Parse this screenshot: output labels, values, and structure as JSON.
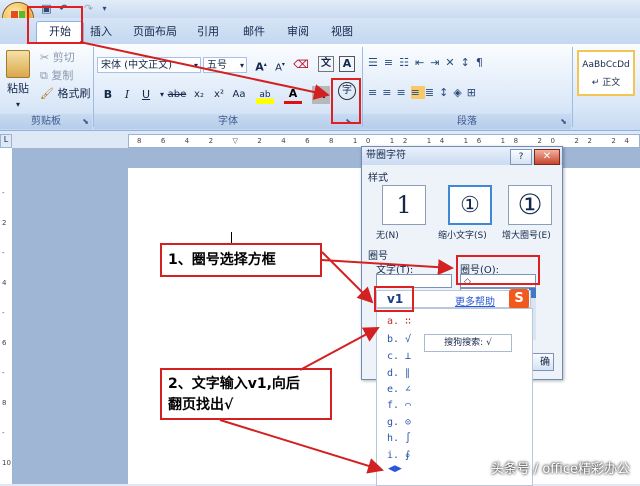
{
  "tabs": [
    "开始",
    "插入",
    "页面布局",
    "引用",
    "邮件",
    "审阅",
    "视图"
  ],
  "clipboard": {
    "paste": "粘贴",
    "cut": "剪切",
    "copy": "复制",
    "format_painter": "格式刷",
    "label": "剪贴板"
  },
  "font": {
    "name": "宋体 (中文正文)",
    "size": "五号",
    "label": "字体",
    "grow": "A",
    "shrink": "A",
    "char_border": "A",
    "bold": "B",
    "italic": "I",
    "underline": "U",
    "strike": "abe",
    "subscript": "x₂",
    "superscript": "x²",
    "change_case": "Aa",
    "highlight": "ab",
    "font_color": "A",
    "char_shading": "A",
    "enclose_char": "字"
  },
  "paragraph": {
    "label": "段落"
  },
  "styles": {
    "sample": "AaBbCcDd",
    "normal": "↵ 正文"
  },
  "dialog": {
    "title": "带圈字符",
    "style_label": "样式",
    "styles": [
      {
        "glyph": "1",
        "label": "无(N)"
      },
      {
        "glyph": "①",
        "label": "缩小文字(S)"
      },
      {
        "glyph": "①",
        "label": "增大圈号(E)"
      }
    ],
    "circle_section": "圈号",
    "text_label": "文字(T):",
    "circle_label": "圈号(O):",
    "circle_value": "◇",
    "ime_input": "v1",
    "more_help": "更多帮助",
    "ok": "确"
  },
  "ime": {
    "candidates": [
      "a. ∷",
      "b. √",
      "c. ⊥",
      "d. ∥",
      "e. ∠",
      "f. ⌒",
      "g. ⊙",
      "h. ∫",
      "i. ∮"
    ],
    "sogou_search": "搜狗搜索: √"
  },
  "annotations": {
    "step1": "1、圈号选择方框",
    "step2_line1": "2、文字输入v1,向后",
    "step2_line2": "翻页找出√"
  },
  "watermark": "头条号 / office精彩办公"
}
